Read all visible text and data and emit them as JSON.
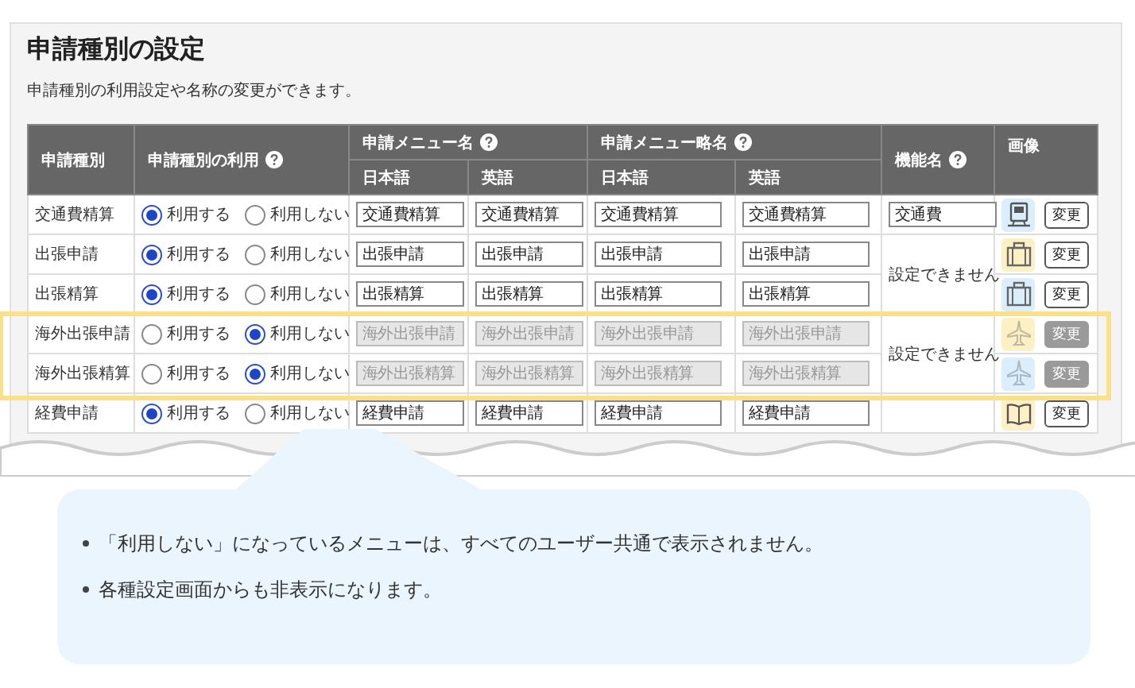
{
  "title": "申請種別の設定",
  "description": "申請種別の利用設定や名称の変更ができます。",
  "columns": [
    {
      "label": "申請種別",
      "help": false
    },
    {
      "label": "申請種別の利用",
      "help": true
    },
    {
      "label": "申請メニュー名",
      "help": true,
      "children": [
        {
          "label": "日本語"
        },
        {
          "label": "英語"
        }
      ]
    },
    {
      "label": "申請メニュー略名",
      "help": true,
      "children": [
        {
          "label": "日本語"
        },
        {
          "label": "英語"
        }
      ]
    },
    {
      "label": "機能名",
      "help": true
    },
    {
      "label": "画像",
      "help": false
    }
  ],
  "rows": [
    {
      "type": "交通費精算",
      "highlighted": false,
      "disabled": false,
      "usage": [
        {
          "label": "利用する",
          "selected": true
        },
        {
          "label": "利用しない",
          "selected": false
        }
      ],
      "menu_ja": "交通費精算",
      "menu_en": "交通費精算",
      "short_ja": "交通費精算",
      "short_en": "交通費精算",
      "function_name": {
        "kind": "field",
        "value": "交通費"
      },
      "image": {
        "kind": "train",
        "color": "#dbeefe"
      },
      "button": "変更"
    },
    {
      "type": "出張申請",
      "highlighted": false,
      "disabled": false,
      "usage": [
        {
          "label": "利用する",
          "selected": true
        },
        {
          "label": "利用しない",
          "selected": false
        }
      ],
      "menu_ja": "出張申請",
      "menu_en": "出張申請",
      "short_ja": "出張申請",
      "short_en": "出張申請",
      "function_name": {
        "kind": "note",
        "value": "設定できません"
      },
      "image": {
        "kind": "briefcase",
        "color": "#fdf0c4"
      },
      "button": "変更"
    },
    {
      "type": "出張精算",
      "highlighted": false,
      "disabled": false,
      "usage": [
        {
          "label": "利用する",
          "selected": true
        },
        {
          "label": "利用しない",
          "selected": false
        }
      ],
      "menu_ja": "出張精算",
      "menu_en": "出張精算",
      "short_ja": "出張精算",
      "short_en": "出張精算",
      "function_name": {
        "kind": "continued"
      },
      "image": {
        "kind": "briefcase",
        "color": "#dbeefe"
      },
      "button": "変更"
    },
    {
      "type": "海外出張申請",
      "highlighted": true,
      "disabled": true,
      "usage": [
        {
          "label": "利用する",
          "selected": false
        },
        {
          "label": "利用しない",
          "selected": true
        }
      ],
      "menu_ja": "海外出張申請",
      "menu_en": "海外出張申請",
      "short_ja": "海外出張申請",
      "short_en": "海外出張申請",
      "function_name": {
        "kind": "note",
        "value": "設定できません"
      },
      "image": {
        "kind": "airplane",
        "color": "#fdf0c4"
      },
      "button": "変更"
    },
    {
      "type": "海外出張精算",
      "highlighted": true,
      "disabled": true,
      "usage": [
        {
          "label": "利用する",
          "selected": false
        },
        {
          "label": "利用しない",
          "selected": true
        }
      ],
      "menu_ja": "海外出張精算",
      "menu_en": "海外出張精算",
      "short_ja": "海外出張精算",
      "short_en": "海外出張精算",
      "function_name": {
        "kind": "continued"
      },
      "image": {
        "kind": "airplane",
        "color": "#dbeefe"
      },
      "button": "変更"
    },
    {
      "type": "経費申請",
      "highlighted": false,
      "disabled": false,
      "usage": [
        {
          "label": "利用する",
          "selected": true
        },
        {
          "label": "利用しない",
          "selected": false
        }
      ],
      "menu_ja": "経費申請",
      "menu_en": "経費申請",
      "short_ja": "経費申請",
      "short_en": "経費申請",
      "function_name": {
        "kind": "blank"
      },
      "image": {
        "kind": "book",
        "color": "#fdf0c4"
      },
      "button": "変更"
    }
  ],
  "notes": [
    "「利用しない」になっているメニューは、すべてのユーザー共通で表示されません。",
    "各種設定画面からも非表示になります。"
  ]
}
